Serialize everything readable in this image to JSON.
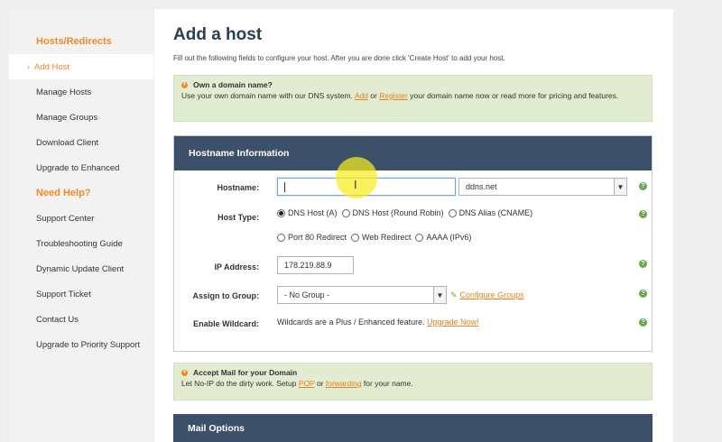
{
  "sidebar": {
    "heading_hosts": "Hosts/Redirects",
    "items_hosts": [
      {
        "label": "Add Host",
        "active": true
      },
      {
        "label": "Manage Hosts"
      },
      {
        "label": "Manage Groups"
      },
      {
        "label": "Download Client"
      },
      {
        "label": "Upgrade to Enhanced"
      }
    ],
    "heading_help": "Need Help?",
    "items_help": [
      {
        "label": "Support Center"
      },
      {
        "label": "Troubleshooting Guide"
      },
      {
        "label": "Dynamic Update Client"
      },
      {
        "label": "Support Ticket"
      },
      {
        "label": "Contact Us"
      },
      {
        "label": "Upgrade to Priority Support"
      }
    ]
  },
  "main": {
    "title": "Add a host",
    "intro": "Fill out the following fields to configure your host. After you are done click 'Create Host' to add your host.",
    "domain_promo": {
      "title": "Own a domain name?",
      "text1": "Use your own domain name with our DNS system. ",
      "link_add": "Add",
      "text2": " or ",
      "link_register": "Register",
      "text3": " your domain name now or read more for pricing and features."
    },
    "hostname_panel": {
      "header": "Hostname Information",
      "hostname_label": "Hostname:",
      "hostname_value": "",
      "domain_value": "ddns.net",
      "host_type_label": "Host Type:",
      "host_types": [
        {
          "label": "DNS Host (A)",
          "checked": true
        },
        {
          "label": "DNS Host (Round Robin)"
        },
        {
          "label": "DNS Alias (CNAME)"
        },
        {
          "label": "Port 80 Redirect"
        },
        {
          "label": "Web Redirect"
        },
        {
          "label": "AAAA (IPv6)"
        }
      ],
      "ip_label": "IP Address:",
      "ip_value": "178.219.88.9",
      "group_label": "Assign to Group:",
      "group_value": "- No Group -",
      "configure_groups": "Configure Groups",
      "wildcard_label": "Enable Wildcard:",
      "wildcard_text": "Wildcards are a Plus / Enhanced feature. ",
      "upgrade_now": "Upgrade Now!"
    },
    "mail_promo": {
      "title": "Accept Mail for your Domain",
      "text1": "Let No-IP do the dirty work. Setup ",
      "link_pop": "POP",
      "text2": " or ",
      "link_forwarding": "forwarding",
      "text3": " for your name."
    },
    "mail_options_header": "Mail Options"
  },
  "colors": {
    "accent": "#f08a24",
    "panel_header": "#3c5069",
    "promo_bg": "#e1ecd0",
    "help_icon": "#6aa84f"
  },
  "icons": {
    "help": "question-icon",
    "dropdown": "chevron-down-icon",
    "promo": "plus-icon"
  }
}
